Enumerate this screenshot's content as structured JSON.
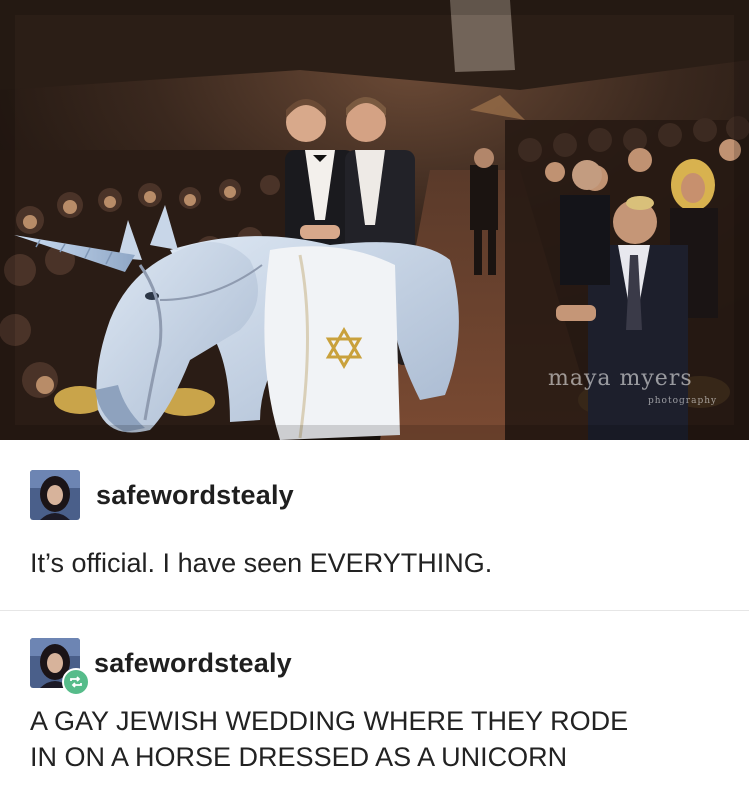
{
  "photo": {
    "alt_icon": "wedding-photo",
    "watermark_main": "maya myers",
    "watermark_sub": "photography"
  },
  "posts": [
    {
      "username": "safewordstealy",
      "text": "It’s official. I have seen EVERYTHING.",
      "avatar_icon": "user-avatar-icon",
      "reblogged": false
    },
    {
      "username": "safewordstealy",
      "text_line1": "A GAY JEWISH WEDDING WHERE THEY RODE",
      "text_line2": "IN ON A HORSE DRESSED AS A UNICORN",
      "avatar_icon": "user-avatar-icon",
      "reblog_icon": "reblog-icon",
      "reblogged": true
    }
  ],
  "colors": {
    "reblog_badge": "#56bc8a",
    "divider": "#e6e6e6",
    "text": "#222222"
  }
}
